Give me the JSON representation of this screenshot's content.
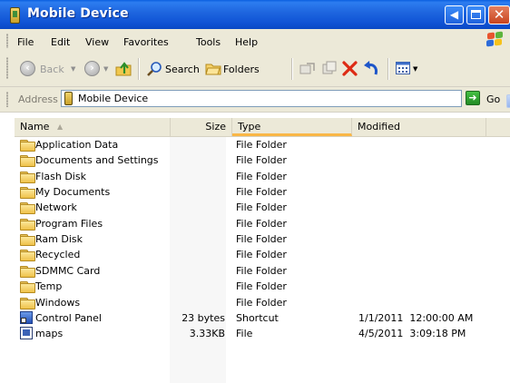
{
  "window": {
    "title": "Mobile Device"
  },
  "menu": [
    "File",
    "Edit",
    "View",
    "Favorites",
    "Tools",
    "Help"
  ],
  "toolbar": {
    "back_label": "Back",
    "search_label": "Search",
    "folders_label": "Folders"
  },
  "address": {
    "label": "Address",
    "value": "Mobile Device",
    "go_label": "Go"
  },
  "columns": {
    "name": "Name",
    "size": "Size",
    "type": "Type",
    "modified": "Modified"
  },
  "sorted_column": "name",
  "items": [
    {
      "name": "Application Data",
      "size": "",
      "type": "File Folder",
      "modified": "",
      "icon": "folder-icon"
    },
    {
      "name": "Documents and Settings",
      "size": "",
      "type": "File Folder",
      "modified": "",
      "icon": "folder-icon"
    },
    {
      "name": "Flash Disk",
      "size": "",
      "type": "File Folder",
      "modified": "",
      "icon": "folder-icon"
    },
    {
      "name": "My Documents",
      "size": "",
      "type": "File Folder",
      "modified": "",
      "icon": "folder-icon"
    },
    {
      "name": "Network",
      "size": "",
      "type": "File Folder",
      "modified": "",
      "icon": "folder-icon"
    },
    {
      "name": "Program Files",
      "size": "",
      "type": "File Folder",
      "modified": "",
      "icon": "folder-icon"
    },
    {
      "name": "Ram Disk",
      "size": "",
      "type": "File Folder",
      "modified": "",
      "icon": "folder-icon"
    },
    {
      "name": "Recycled",
      "size": "",
      "type": "File Folder",
      "modified": "",
      "icon": "folder-icon"
    },
    {
      "name": "SDMMC Card",
      "size": "",
      "type": "File Folder",
      "modified": "",
      "icon": "folder-icon"
    },
    {
      "name": "Temp",
      "size": "",
      "type": "File Folder",
      "modified": "",
      "icon": "folder-icon"
    },
    {
      "name": "Windows",
      "size": "",
      "type": "File Folder",
      "modified": "",
      "icon": "folder-icon"
    },
    {
      "name": "Control Panel",
      "size": "23 bytes",
      "type": "Shortcut",
      "modified": "1/1/2011  12:00:00 AM",
      "icon": "shortcut-icon"
    },
    {
      "name": "maps",
      "size": "3.33KB",
      "type": "File",
      "modified": "4/5/2011  3:09:18 PM",
      "icon": "file-icon"
    }
  ]
}
